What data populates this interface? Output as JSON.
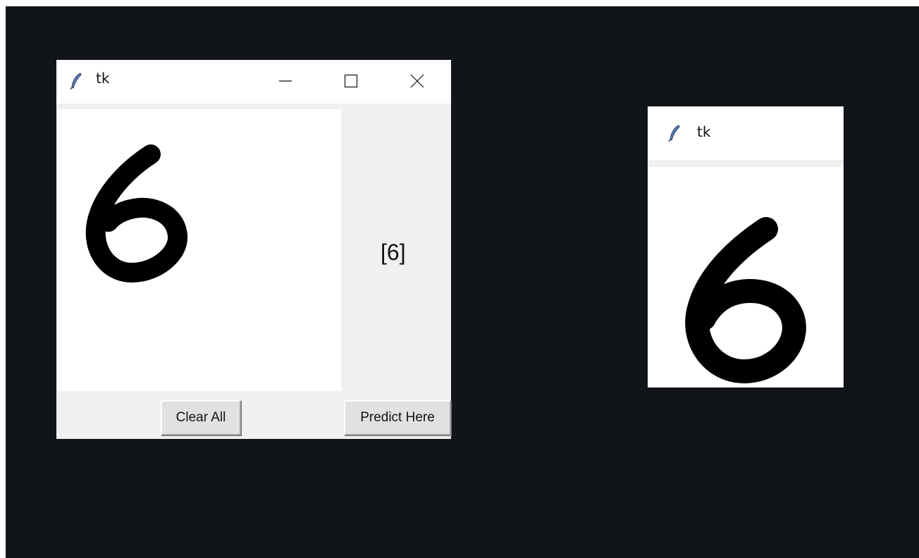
{
  "main_window": {
    "title": "tk",
    "prediction": "[6]",
    "clear_button_label": "Clear All",
    "predict_button_label": "Predict Here"
  },
  "preview_window": {
    "title": "tk"
  },
  "colors": {
    "desktop_background": "#111418",
    "window_background": "#f0f0f0",
    "canvas_background": "#ffffff",
    "ink": "#000000",
    "feather_icon": "#5b7fb8"
  },
  "icons": {
    "app_icon": "feather-icon",
    "minimize": "minimize-icon",
    "maximize": "maximize-icon",
    "close": "close-icon"
  }
}
